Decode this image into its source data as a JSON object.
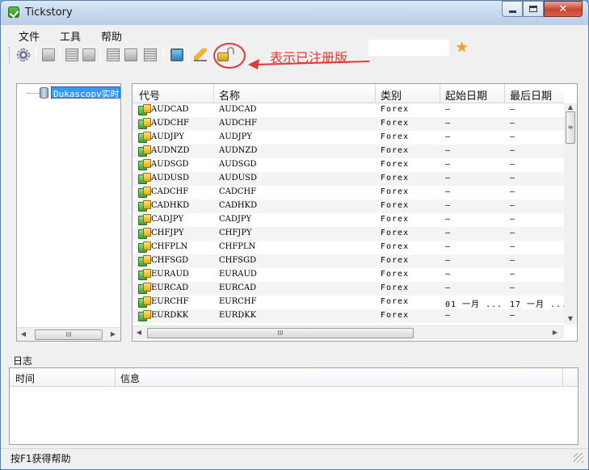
{
  "window": {
    "title": "Tickstory",
    "close_glyph": "✕"
  },
  "menu": {
    "items": [
      "文件",
      "工具",
      "帮助"
    ]
  },
  "annotation": {
    "text": "表示已注册版"
  },
  "tree": {
    "node_label": "Dukascopy实时数据"
  },
  "grid": {
    "columns": [
      "代号",
      "名称",
      "类别",
      "起始日期",
      "最后日期"
    ],
    "rows": [
      {
        "code": "AUDCAD",
        "name": "AUDCAD",
        "type": "Forex",
        "start": "–",
        "end": "–"
      },
      {
        "code": "AUDCHF",
        "name": "AUDCHF",
        "type": "Forex",
        "start": "–",
        "end": "–"
      },
      {
        "code": "AUDJPY",
        "name": "AUDJPY",
        "type": "Forex",
        "start": "–",
        "end": "–"
      },
      {
        "code": "AUDNZD",
        "name": "AUDNZD",
        "type": "Forex",
        "start": "–",
        "end": "–"
      },
      {
        "code": "AUDSGD",
        "name": "AUDSGD",
        "type": "Forex",
        "start": "–",
        "end": "–"
      },
      {
        "code": "AUDUSD",
        "name": "AUDUSD",
        "type": "Forex",
        "start": "–",
        "end": "–"
      },
      {
        "code": "CADCHF",
        "name": "CADCHF",
        "type": "Forex",
        "start": "–",
        "end": "–"
      },
      {
        "code": "CADHKD",
        "name": "CADHKD",
        "type": "Forex",
        "start": "–",
        "end": "–"
      },
      {
        "code": "CADJPY",
        "name": "CADJPY",
        "type": "Forex",
        "start": "–",
        "end": "–"
      },
      {
        "code": "CHFJPY",
        "name": "CHFJPY",
        "type": "Forex",
        "start": "–",
        "end": "–"
      },
      {
        "code": "CHFPLN",
        "name": "CHFPLN",
        "type": "Forex",
        "start": "–",
        "end": "–"
      },
      {
        "code": "CHFSGD",
        "name": "CHFSGD",
        "type": "Forex",
        "start": "–",
        "end": "–"
      },
      {
        "code": "EURAUD",
        "name": "EURAUD",
        "type": "Forex",
        "start": "–",
        "end": "–"
      },
      {
        "code": "EURCAD",
        "name": "EURCAD",
        "type": "Forex",
        "start": "–",
        "end": "–"
      },
      {
        "code": "EURCHF",
        "name": "EURCHF",
        "type": "Forex",
        "start": "01 一月 ...",
        "end": "17 一月 ..."
      },
      {
        "code": "EURDKK",
        "name": "EURDKK",
        "type": "Forex",
        "start": "–",
        "end": "–"
      }
    ],
    "scroll_thumb_glyph": "III"
  },
  "log": {
    "label": "日志",
    "columns": [
      "时间",
      "信息"
    ]
  },
  "status": {
    "text": "按F1获得帮助"
  },
  "colors": {
    "annotation": "#e03a35",
    "selection": "#3399ff",
    "star": "#f0a41d"
  }
}
